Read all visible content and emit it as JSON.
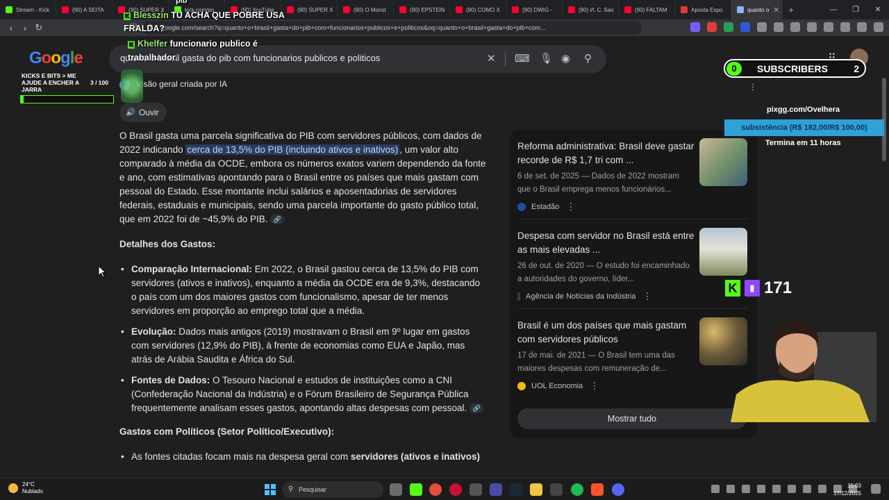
{
  "browser": {
    "tabs": [
      {
        "label": "Stream - Kick",
        "color": "#53fc18"
      },
      {
        "label": "(90) A SEITA",
        "color": "#ff0033"
      },
      {
        "label": "(90) SUPER X",
        "color": "#ff0033"
      },
      {
        "label": "kick.com/po",
        "color": "#53fc18"
      },
      {
        "label": "(90) YouTube",
        "color": "#ff0033"
      },
      {
        "label": "(90) SUPER X",
        "color": "#ff0033"
      },
      {
        "label": "(90) O Monst",
        "color": "#ff0033"
      },
      {
        "label": "(90) EPSTEIN",
        "color": "#ff0033"
      },
      {
        "label": "(90) COMO X",
        "color": "#ff0033"
      },
      {
        "label": "(90) DWIG -",
        "color": "#ff0033"
      },
      {
        "label": "(90) И. С. Бах",
        "color": "#ff0033"
      },
      {
        "label": "(90) FALTAM",
        "color": "#ff0033"
      },
      {
        "label": "Aposta Espo",
        "color": "#e03c31"
      },
      {
        "label": "quanto o",
        "color": "#8ab4f8",
        "active": true
      }
    ],
    "new_tab": "+",
    "url": "google.com/search?q=quanto+o+brasil+gasta+do+pib+com+funcionarios+publicos+e+politicos&oq=quanto+o+brasil+gasta+do+pib+com..."
  },
  "google": {
    "logo": "Google",
    "query": "quanto o brasil gasta do pib com funcionarios publicos e politicos",
    "ai_header": "Visão geral criada por IA",
    "listen_label": "Ouvir",
    "paragraph_pre": "O Brasil gasta uma parcela significativa do PIB com servidores públicos, com dados de 2022 indicando ",
    "paragraph_highlight": "cerca de 13,5% do PIB (incluindo ativos e inativos)",
    "paragraph_post": ", um valor alto comparado à média da OCDE, embora os números exatos variem dependendo da fonte e ano, com estimativas apontando para o Brasil entre os países que mais gastam com pessoal do Estado. Esse montante inclui salários e aposentadorias de servidores federais, estaduais e municipais, sendo uma parcela importante do gasto público total, que em 2022 foi de ~45,9% do PIB.",
    "details_heading": "Detalhes dos Gastos:",
    "bullets": [
      {
        "bold": "Comparação Internacional:",
        "text": " Em 2022, o Brasil gastou cerca de 13,5% do PIB com servidores (ativos e inativos), enquanto a média da OCDE era de 9,3%, destacando o país com um dos maiores gastos com funcionalismo, apesar de ter menos servidores em proporção ao emprego total que a média."
      },
      {
        "bold": "Evolução:",
        "text": " Dados mais antigos (2019) mostravam o Brasil em 9º lugar em gastos com servidores (12,9% do PIB), à frente de economias como EUA e Japão, mas atrás de Arábia Saudita e África do Sul."
      },
      {
        "bold": "Fontes de Dados:",
        "text": " O Tesouro Nacional e estudos de instituições como a CNI (Confederação Nacional da Indústria) e o Fórum Brasileiro de Segurança Pública frequentemente analisam esses gastos, apontando altas despesas com pessoal."
      }
    ],
    "politicians_heading": "Gastos com Políticos (Setor Político/Executivo):",
    "last_bullet_pre": "As fontes citadas focam mais na despesa geral com ",
    "last_bullet_bold": "servidores (ativos e inativos)",
    "sources": [
      {
        "title": "Reforma administrativa: Brasil deve gastar recorde de R$ 1,7 tri com ...",
        "snippet": "6 de set. de 2025 — Dados de 2022 mostram que o Brasil emprega menos funcionários...",
        "publisher": "Estadão",
        "fav_color": "#1f4fa3"
      },
      {
        "title": "Despesa com servidor no Brasil está entre as mais elevadas ...",
        "snippet": "26 de out. de 2020 — O estudo foi encaminhado a autoridades do governo, líder...",
        "publisher": "Agência de Notícias da Indústria",
        "fav_color": "#3a3a3a"
      },
      {
        "title": "Brasil é um dos países que mais gastam com servidores públicos",
        "snippet": "17 de mai. de 2021 — O Brasil tem uma das maiores despesas com remuneração de...",
        "publisher": "UOL Economia",
        "fav_color": "#f2b90f"
      }
    ],
    "show_all": "Mostrar tudo"
  },
  "overlay": {
    "kicks_title": "KICKS E BITS > ME AJUDE A ENCHER A JARRA",
    "kicks_count": "3 / 100",
    "kicks_progress": 0.03,
    "chat": [
      {
        "user": "pib",
        "text": ""
      },
      {
        "user": "Blesszin",
        "text": "TU ACHA QUE POBRE USA FRALDA?"
      },
      {
        "user": "Khelfer",
        "text": "funcionario publico é trabalhador"
      }
    ],
    "subscribers_left": "0",
    "subscribers_label": "SUBSCRIBERS",
    "subscribers_right": "2",
    "pix": "pixgg.com/Ovelhera",
    "goal": "subsistência (R$ 182,00/R$ 100,00)",
    "ends": "Termina em 11 horas",
    "viewers": "171",
    "kick_letter": "K"
  },
  "taskbar": {
    "temp": "24°C",
    "weather": "Nublado",
    "search_label": "Pesquisar",
    "time": "15:03",
    "date": "17/12/2025"
  }
}
